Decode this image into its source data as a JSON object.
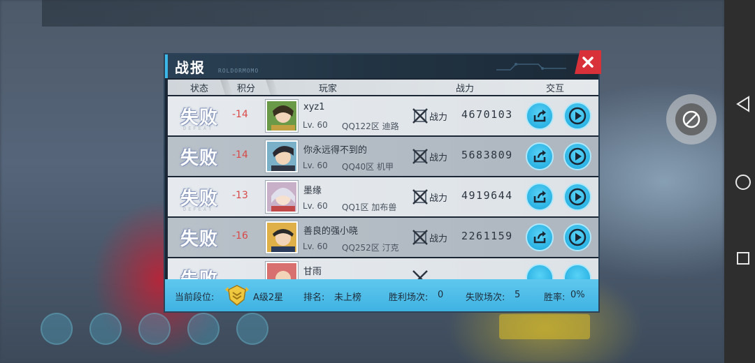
{
  "dialog": {
    "title": "战报",
    "subtitle": "ROLDORMOMO",
    "close_icon": "close-icon"
  },
  "columns": {
    "status": "状态",
    "score": "积分",
    "player": "玩家",
    "power": "战力",
    "interact": "交互"
  },
  "rows": [
    {
      "result": "失败",
      "result_en": "DEFEAT",
      "score": "-14",
      "name": "xyz1",
      "level": "Lv. 60",
      "server": "QQ122区 迪路",
      "power_label": "战力",
      "power": "4670103",
      "avatar_color": "#6a9a48"
    },
    {
      "result": "失败",
      "result_en": "DEFEAT",
      "score": "-14",
      "name": "你永远得不到的",
      "level": "Lv. 60",
      "server": "QQ40区 机甲",
      "power_label": "战力",
      "power": "5683809",
      "avatar_color": "#3a3f4a"
    },
    {
      "result": "失败",
      "result_en": "DEFEAT",
      "score": "-13",
      "name": "墨缘",
      "level": "Lv. 60",
      "server": "QQ1区 加布兽",
      "power_label": "战力",
      "power": "4919644",
      "avatar_color": "#c0bfd0"
    },
    {
      "result": "失败",
      "result_en": "DEFEAT",
      "score": "-16",
      "name": "善良的强小晓",
      "level": "Lv. 60",
      "server": "QQ252区 汀克",
      "power_label": "战力",
      "power": "2261159",
      "avatar_color": "#d8a040"
    },
    {
      "result": "失败",
      "result_en": "DEFEAT",
      "score": "",
      "name": "甘雨",
      "level": "",
      "server": "",
      "power_label": "",
      "power": "",
      "avatar_color": "#d06060"
    }
  ],
  "footer": {
    "rank_label": "当前段位:",
    "rank_value": "A级2星",
    "position_label": "排名:",
    "position_value": "未上榜",
    "wins_label": "胜利场次:",
    "wins_value": "0",
    "losses_label": "失败场次:",
    "losses_value": "5",
    "rate_label": "胜率:",
    "rate_value": "0%"
  },
  "colors": {
    "accent": "#3bb8e8",
    "close": "#d9313a",
    "score_negative": "#d84848",
    "footer": "#4fbee8"
  },
  "icons": {
    "share": "share-icon",
    "play": "play-icon",
    "power": "crossed-swords-icon",
    "rank_badge": "rank-badge-icon",
    "nav_back": "back-triangle-icon",
    "nav_home": "home-circle-icon",
    "nav_recent": "recent-square-icon",
    "assistive": "assistive-touch-icon"
  }
}
